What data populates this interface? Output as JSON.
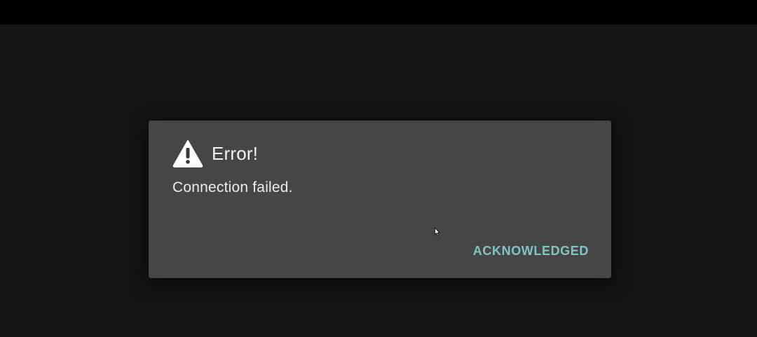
{
  "dialog": {
    "icon": "warning-triangle-icon",
    "title": "Error!",
    "message": "Connection failed.",
    "button_label": "ACKNOWLEDGED"
  },
  "colors": {
    "background": "#141414",
    "top_bar": "#000000",
    "dialog_background": "#464646",
    "text": "#f2f2f2",
    "accent": "#7fc5c4"
  },
  "cursor_icon": "mouse-pointer-icon"
}
